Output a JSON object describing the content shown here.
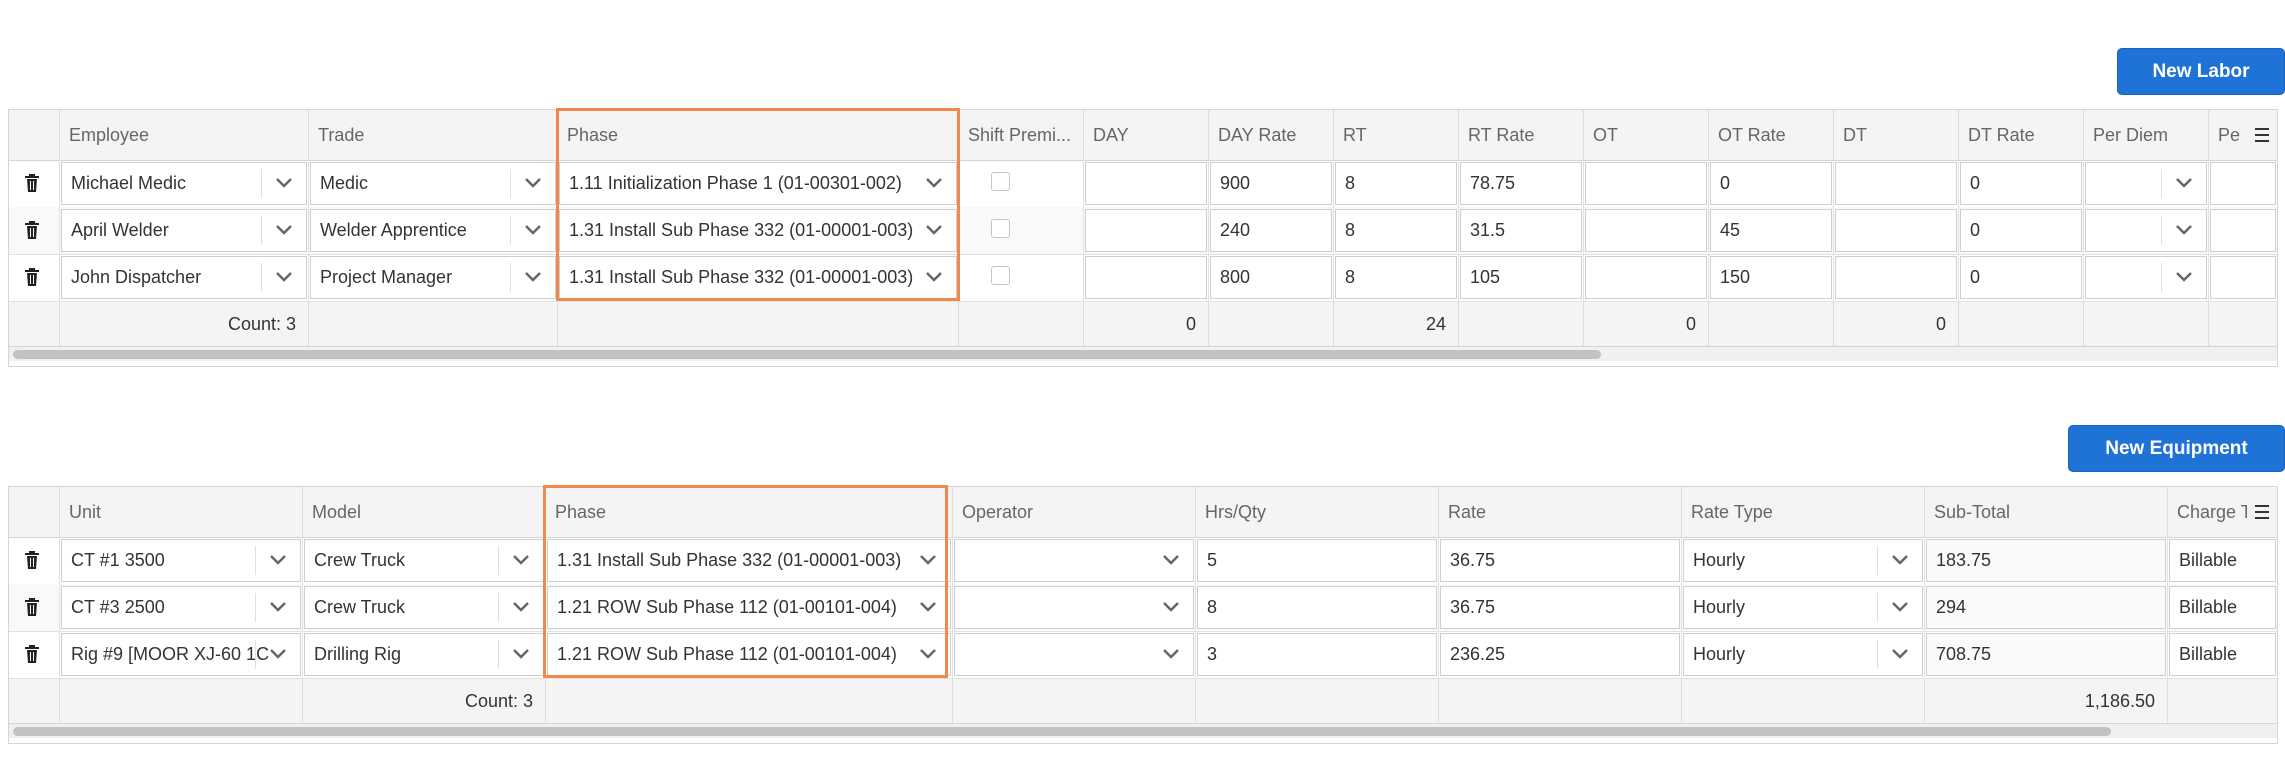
{
  "labor": {
    "new_button_label": "New Labor",
    "columns": [
      "",
      "Employee",
      "Trade",
      "Phase",
      "Shift Premi...",
      "DAY",
      "DAY Rate",
      "RT",
      "RT Rate",
      "OT",
      "OT Rate",
      "DT",
      "DT Rate",
      "Per Diem",
      "Pe"
    ],
    "rows": [
      {
        "employee": "Michael Medic",
        "trade": "Medic",
        "phase": "1.11 Initialization Phase 1 (01-00301-002)",
        "shift_premium": false,
        "day": "",
        "day_rate": "900",
        "rt": "8",
        "rt_rate": "78.75",
        "ot": "",
        "ot_rate": "0",
        "dt": "",
        "dt_rate": "0",
        "per_diem": ""
      },
      {
        "employee": "April Welder",
        "trade": "Welder Apprentice",
        "phase": "1.31 Install Sub Phase 332 (01-00001-003)",
        "shift_premium": false,
        "day": "",
        "day_rate": "240",
        "rt": "8",
        "rt_rate": "31.5",
        "ot": "",
        "ot_rate": "45",
        "dt": "",
        "dt_rate": "0",
        "per_diem": ""
      },
      {
        "employee": "John Dispatcher",
        "trade": "Project Manager",
        "phase": "1.31 Install Sub Phase 332 (01-00001-003)",
        "shift_premium": false,
        "day": "",
        "day_rate": "800",
        "rt": "8",
        "rt_rate": "105",
        "ot": "",
        "ot_rate": "150",
        "dt": "",
        "dt_rate": "0",
        "per_diem": ""
      }
    ],
    "footer": {
      "count": "Count: 3",
      "day_total": "0",
      "rt_total": "24",
      "ot_total": "0",
      "dt_total": "0"
    }
  },
  "equipment": {
    "new_button_label": "New Equipment",
    "columns": [
      "",
      "Unit",
      "Model",
      "Phase",
      "Operator",
      "Hrs/Qty",
      "Rate",
      "Rate Type",
      "Sub-Total",
      "Charge T"
    ],
    "rows": [
      {
        "unit": "CT #1 3500",
        "model": "Crew Truck",
        "phase": "1.31 Install Sub Phase 332 (01-00001-003)",
        "operator": "",
        "hrs_qty": "5",
        "rate": "36.75",
        "rate_type": "Hourly",
        "sub_total": "183.75",
        "charge_type": "Billable"
      },
      {
        "unit": "CT #3 2500",
        "model": "Crew Truck",
        "phase": "1.21 ROW Sub Phase 112 (01-00101-004)",
        "operator": "",
        "hrs_qty": "8",
        "rate": "36.75",
        "rate_type": "Hourly",
        "sub_total": "294",
        "charge_type": "Billable"
      },
      {
        "unit": "Rig #9 [MOOR XJ-60 1C",
        "model": "Drilling Rig",
        "phase": "1.21 ROW Sub Phase 112 (01-00101-004)",
        "operator": "",
        "hrs_qty": "3",
        "rate": "236.25",
        "rate_type": "Hourly",
        "sub_total": "708.75",
        "charge_type": "Billable"
      }
    ],
    "footer": {
      "count": "Count: 3",
      "sub_total": "1,186.50"
    }
  },
  "icons": [
    "trash-icon",
    "chevron-down-icon",
    "column-menu-icon",
    "checkbox"
  ],
  "colors": {
    "primary_button": "#1f72d6",
    "highlight": "#f08a4b",
    "header_bg": "#f4f4f4"
  }
}
